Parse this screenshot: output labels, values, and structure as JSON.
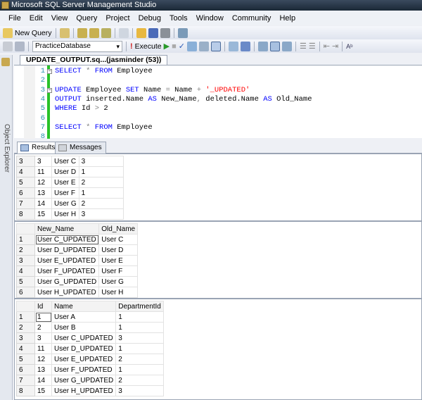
{
  "window": {
    "title": "Microsoft SQL Server Management Studio"
  },
  "menu": [
    "File",
    "Edit",
    "View",
    "Query",
    "Project",
    "Debug",
    "Tools",
    "Window",
    "Community",
    "Help"
  ],
  "toolbar": {
    "new_query": "New Query",
    "database": "PracticeDatabase",
    "execute": "Execute"
  },
  "sidebar": {
    "object_explorer": "Object Explorer"
  },
  "document_tab": "UPDATE_OUTPUT.sq...(jasminder (53))",
  "editor": {
    "lines": [
      {
        "n": "1",
        "parts": [
          [
            "kw",
            "SELECT "
          ],
          [
            "op",
            "* "
          ],
          [
            "kw",
            "FROM "
          ],
          [
            "",
            "Employee"
          ]
        ]
      },
      {
        "n": "2",
        "parts": []
      },
      {
        "n": "3",
        "parts": [
          [
            "kw",
            "UPDATE "
          ],
          [
            "",
            "Employee "
          ],
          [
            "kw",
            "SET "
          ],
          [
            "",
            "Name "
          ],
          [
            "op",
            "= "
          ],
          [
            "",
            "Name "
          ],
          [
            "op",
            "+ "
          ],
          [
            "str",
            "'_UPDATED'"
          ]
        ]
      },
      {
        "n": "4",
        "parts": [
          [
            "kw",
            "OUTPUT "
          ],
          [
            "",
            "inserted.Name "
          ],
          [
            "kw",
            "AS "
          ],
          [
            "",
            "New_Name"
          ],
          [
            "op",
            ", "
          ],
          [
            "",
            "deleted.Name "
          ],
          [
            "kw",
            "AS "
          ],
          [
            "",
            "Old_Name"
          ]
        ]
      },
      {
        "n": "5",
        "parts": [
          [
            "kw",
            "WHERE "
          ],
          [
            "",
            "Id "
          ],
          [
            "op",
            "> "
          ],
          [
            "",
            "2"
          ]
        ]
      },
      {
        "n": "6",
        "parts": []
      },
      {
        "n": "7",
        "parts": [
          [
            "kw",
            "SELECT "
          ],
          [
            "op",
            "* "
          ],
          [
            "kw",
            "FROM "
          ],
          [
            "",
            "Employee"
          ]
        ]
      },
      {
        "n": "8",
        "parts": []
      }
    ]
  },
  "result_tabs": {
    "results": "Results",
    "messages": "Messages"
  },
  "grids": [
    {
      "headers": null,
      "rows": [
        [
          "3",
          "3",
          "User C",
          "3"
        ],
        [
          "4",
          "11",
          "User D",
          "1"
        ],
        [
          "5",
          "12",
          "User E",
          "2"
        ],
        [
          "6",
          "13",
          "User F",
          "1"
        ],
        [
          "7",
          "14",
          "User G",
          "2"
        ],
        [
          "8",
          "15",
          "User H",
          "3"
        ]
      ]
    },
    {
      "headers": [
        "",
        "New_Name",
        "Old_Name"
      ],
      "rows": [
        [
          "1",
          "User C_UPDATED",
          "User C"
        ],
        [
          "2",
          "User D_UPDATED",
          "User D"
        ],
        [
          "3",
          "User E_UPDATED",
          "User E"
        ],
        [
          "4",
          "User F_UPDATED",
          "User F"
        ],
        [
          "5",
          "User G_UPDATED",
          "User G"
        ],
        [
          "6",
          "User H_UPDATED",
          "User H"
        ]
      ]
    },
    {
      "headers": [
        "",
        "Id",
        "Name",
        "DepartmentId"
      ],
      "rows": [
        [
          "1",
          "1",
          "User A",
          "1"
        ],
        [
          "2",
          "2",
          "User B",
          "1"
        ],
        [
          "3",
          "3",
          "User C_UPDATED",
          "3"
        ],
        [
          "4",
          "11",
          "User D_UPDATED",
          "1"
        ],
        [
          "5",
          "12",
          "User E_UPDATED",
          "2"
        ],
        [
          "6",
          "13",
          "User F_UPDATED",
          "1"
        ],
        [
          "7",
          "14",
          "User G_UPDATED",
          "2"
        ],
        [
          "8",
          "15",
          "User H_UPDATED",
          "3"
        ]
      ]
    }
  ]
}
